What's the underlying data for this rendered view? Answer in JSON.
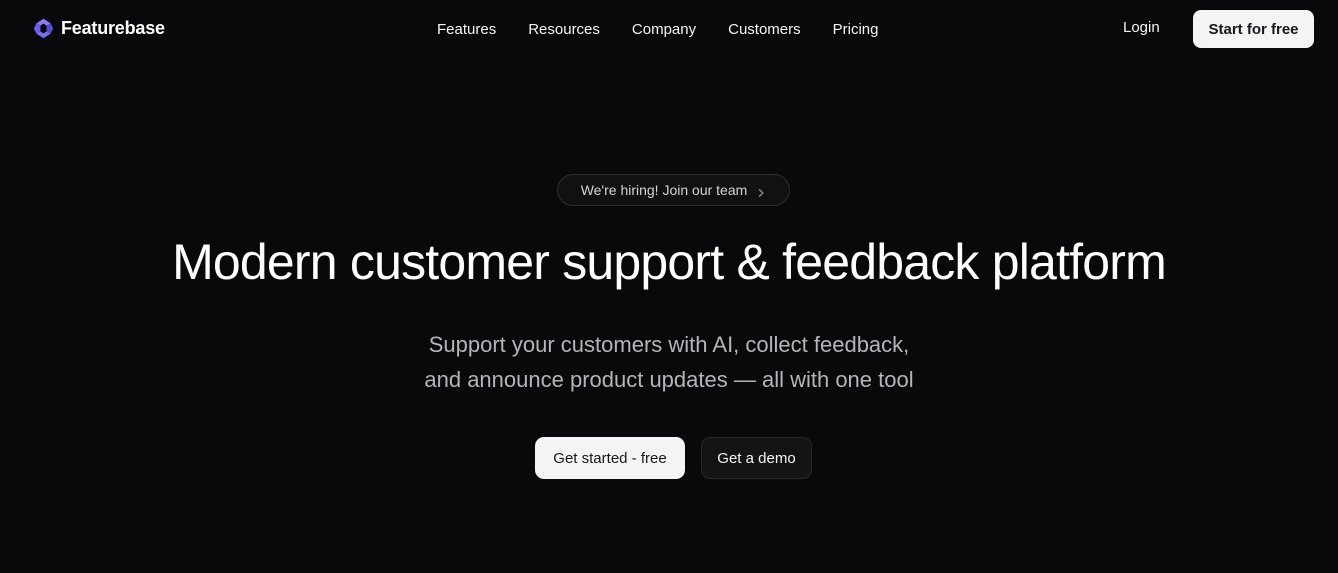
{
  "header": {
    "brand": {
      "name": "Featurebase",
      "icon": "featurebase-logo-icon",
      "accent_color": "#6d5ce7"
    },
    "nav": [
      {
        "label": "Features"
      },
      {
        "label": "Resources"
      },
      {
        "label": "Company"
      },
      {
        "label": "Customers"
      },
      {
        "label": "Pricing"
      }
    ],
    "login_label": "Login",
    "start_label": "Start for free"
  },
  "hero": {
    "hiring_pill": {
      "label": "We're hiring! Join our team",
      "icon": "chevron-right-icon"
    },
    "title": "Modern customer support & feedback platform",
    "subtitle_lines": [
      "Support your customers with AI, collect feedback,",
      "and announce product updates — all with one tool"
    ],
    "cta_primary_label": "Get started - free",
    "cta_secondary_label": "Get a demo"
  },
  "colors": {
    "background": "#09090b",
    "button_light": "#f4f4f5",
    "button_dark": "#141417",
    "subtitle_text": "#b4b4bb"
  }
}
